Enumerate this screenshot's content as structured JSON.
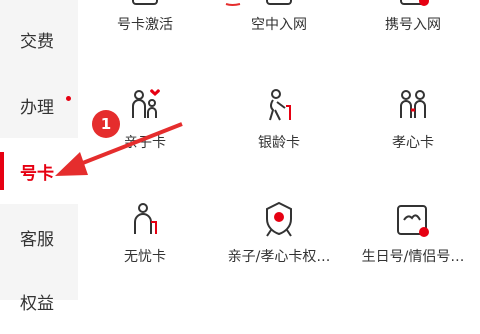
{
  "sidebar": {
    "items": [
      {
        "label": "交费"
      },
      {
        "label": "办理"
      },
      {
        "label": "号卡"
      },
      {
        "label": "客服"
      },
      {
        "label": "权益"
      }
    ]
  },
  "grid": {
    "row1": [
      {
        "label": "号卡激活",
        "icon": "sim-activate-icon"
      },
      {
        "label": "空中入网",
        "icon": "air-network-icon"
      },
      {
        "label": "携号入网",
        "icon": "port-in-icon"
      }
    ],
    "row2": [
      {
        "label": "亲子卡",
        "icon": "parent-child-icon"
      },
      {
        "label": "银龄卡",
        "icon": "elderly-icon"
      },
      {
        "label": "孝心卡",
        "icon": "filial-icon"
      }
    ],
    "row3": [
      {
        "label": "无忧卡",
        "icon": "carefree-icon"
      },
      {
        "label": "亲子/孝心卡权…",
        "icon": "rights-badge-icon"
      },
      {
        "label": "生日号/情侣号…",
        "icon": "birthday-number-icon"
      }
    ]
  },
  "annotation": {
    "step": "1"
  },
  "colors": {
    "accent": "#e60012",
    "annotation": "#e52d2d"
  }
}
